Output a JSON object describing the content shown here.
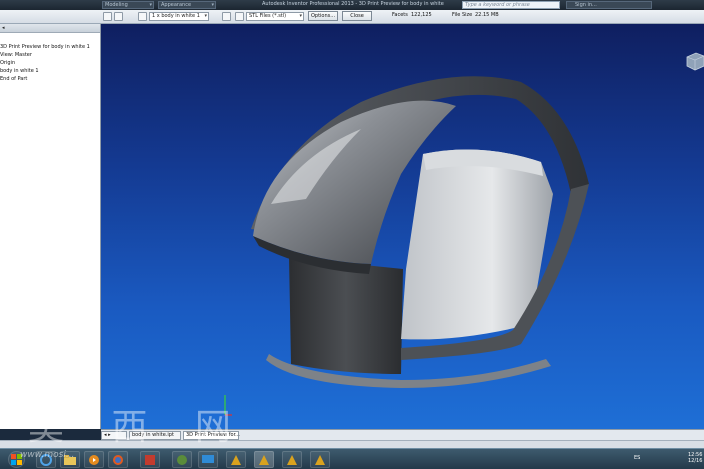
{
  "titlebar": {
    "combo_left": "Modeling",
    "combo_appearance": "Appearance",
    "title": "Autodesk Inventor Professional 2013 - 3D Print Preview for body in white",
    "search_placeholder": "Type a keyword or phrase",
    "user": "Sign in..."
  },
  "toolbar": {
    "body_select": "1 x body in white 1",
    "file_type": "STL Files (*.stl)",
    "options_label": "Options...",
    "close_label": "Close",
    "facets_label": "Facets",
    "facets_value": "122,125",
    "filesize_label": "File Size",
    "filesize_value": "22.15 MB"
  },
  "browser": {
    "items": [
      "3D Print Preview for body in white 1",
      "View: Master",
      "Origin",
      "body in white 1",
      "End of Part"
    ]
  },
  "tabs": [
    {
      "label": "body in white.ipt"
    },
    {
      "label": "3D Print Preview for..."
    }
  ],
  "taskbar": {
    "lang": "ES",
    "time": "12:56",
    "date": "12/16"
  },
  "watermark": {
    "text": "莫 西 网",
    "url": "www.mosi..."
  },
  "colors": {
    "viewport_top": "#0f1f60",
    "viewport_bottom": "#1e6fd6",
    "model_gray": "#8a8f96"
  }
}
